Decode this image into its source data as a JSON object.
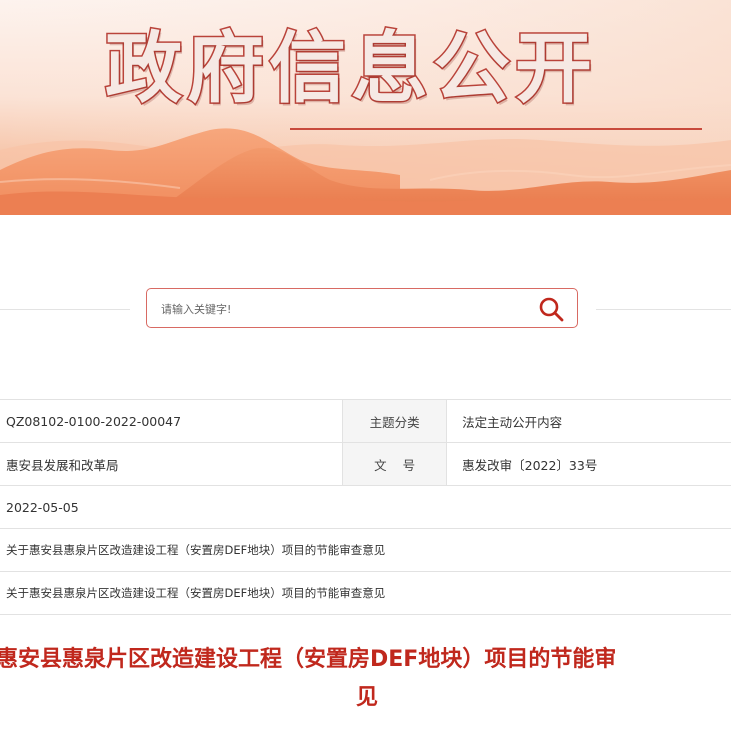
{
  "banner": {
    "title": "政府信息公开"
  },
  "search": {
    "placeholder": "请输入关键字!"
  },
  "info_table": {
    "rows": [
      {
        "value": "QZ08102-0100-2022-00047",
        "key2": "主题分类",
        "value2": "法定主动公开内容"
      },
      {
        "value": "惠安县发展和改革局",
        "key2": "文    号",
        "value2": "惠发改审〔2022〕33号"
      },
      {
        "value": "2022-05-05"
      },
      {
        "value": "关于惠安县惠泉片区改造建设工程（安置房DEF地块）项目的节能审查意见"
      },
      {
        "value": "关于惠安县惠泉片区改造建设工程（安置房DEF地块）项目的节能审查意见"
      }
    ]
  },
  "document": {
    "title_line1": "惠安县惠泉片区改造建设工程（安置房DEF地块）项目的节能审",
    "title_line2": "见"
  },
  "colors": {
    "accent": "#c0281d",
    "border": "#d86a63"
  }
}
